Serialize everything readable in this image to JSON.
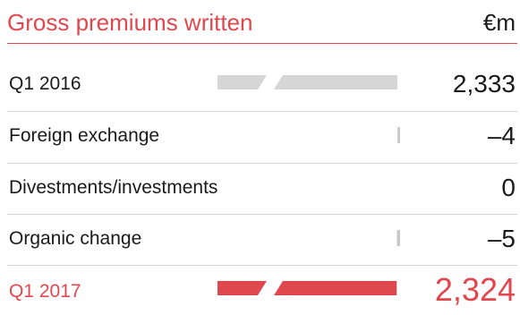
{
  "header": {
    "title": "Gross premiums written",
    "unit": "€m"
  },
  "colors": {
    "accent": "#e0484f",
    "neutral_bar": "#d6d6d6",
    "marker": "#c8c8c8",
    "text": "#1a1a1a"
  },
  "chart_data": {
    "type": "bar",
    "title": "Gross premiums written",
    "unit": "€m",
    "axis_break": true,
    "categories": [
      "Q1 2016",
      "Foreign exchange",
      "Divestments/investments",
      "Organic change",
      "Q1 2017"
    ],
    "values": [
      2333,
      -4,
      0,
      -5,
      2324
    ],
    "value_labels": [
      "2,333",
      "–4",
      "0",
      "–5",
      "2,324"
    ],
    "bar_kinds": [
      "total",
      "delta",
      "delta",
      "delta",
      "total"
    ]
  }
}
